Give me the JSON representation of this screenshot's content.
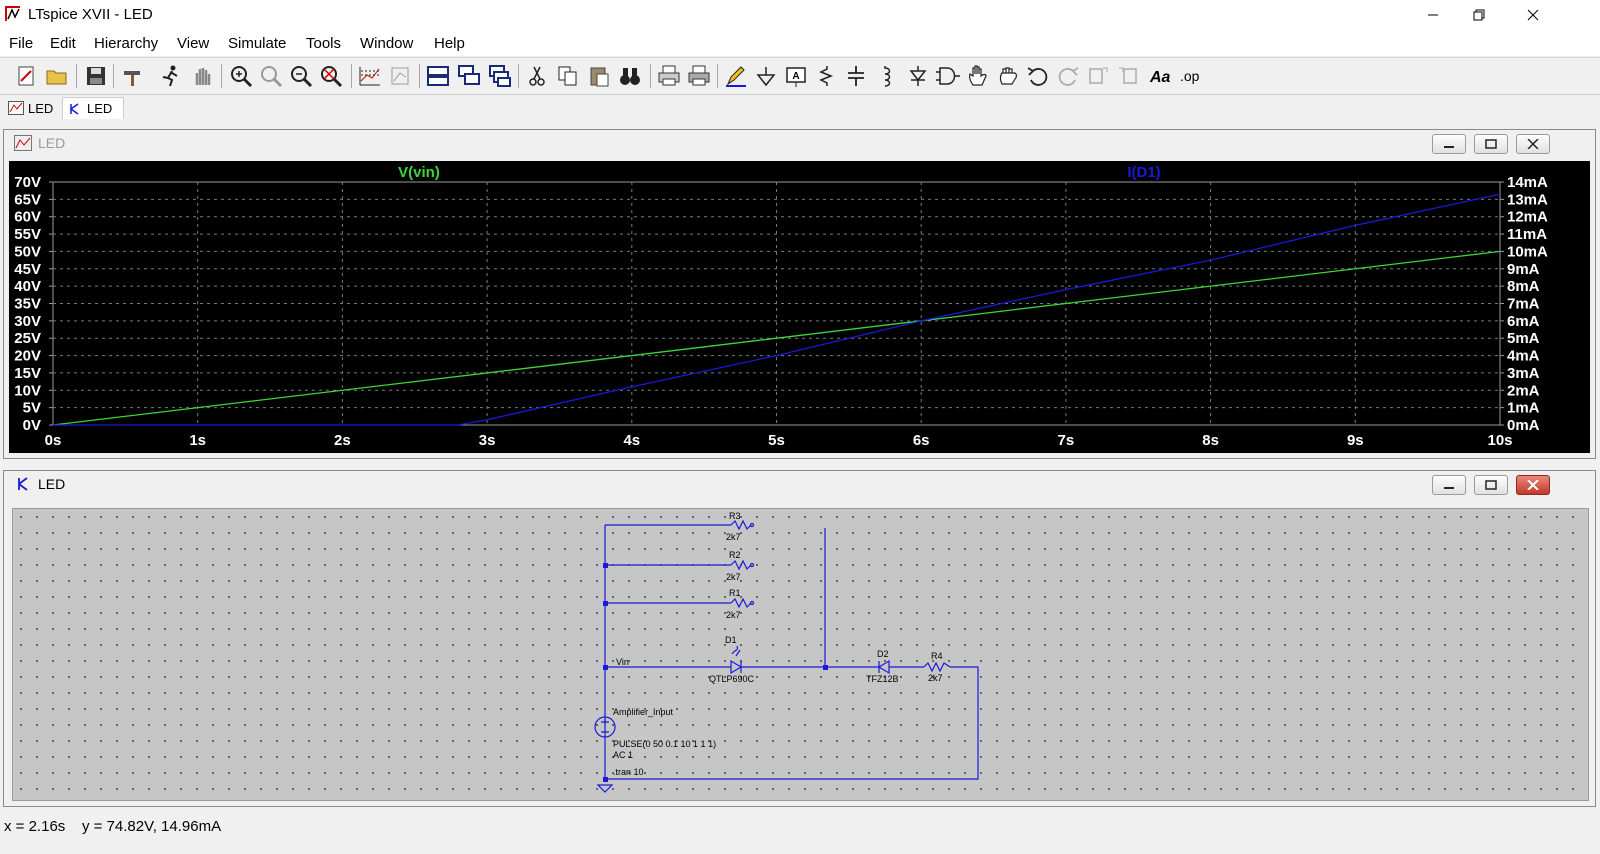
{
  "window": {
    "title": "LTspice XVII - LED"
  },
  "menu": [
    "File",
    "Edit",
    "Hierarchy",
    "View",
    "Simulate",
    "Tools",
    "Window",
    "Help"
  ],
  "tabs": [
    {
      "label": "LED"
    },
    {
      "label": "LED"
    }
  ],
  "waveform_panel": {
    "title": "LED"
  },
  "schematic_panel": {
    "title": "LED"
  },
  "chart_data": {
    "type": "line",
    "x_tick_labels": [
      "0s",
      "1s",
      "2s",
      "3s",
      "4s",
      "5s",
      "6s",
      "7s",
      "8s",
      "9s",
      "10s"
    ],
    "y_left_tick_labels": [
      "0V",
      "5V",
      "10V",
      "15V",
      "20V",
      "25V",
      "30V",
      "35V",
      "40V",
      "45V",
      "50V",
      "55V",
      "60V",
      "65V",
      "70V"
    ],
    "y_right_tick_labels": [
      "0mA",
      "1mA",
      "2mA",
      "3mA",
      "4mA",
      "5mA",
      "6mA",
      "7mA",
      "8mA",
      "9mA",
      "10mA",
      "11mA",
      "12mA",
      "13mA",
      "14mA"
    ],
    "xlim": [
      0,
      10
    ],
    "ylim_left": [
      0,
      70
    ],
    "ylim_right": [
      0,
      14
    ],
    "grid": true,
    "series": [
      {
        "name": "V(vin)",
        "axis": "left",
        "unit": "V",
        "color": "#3cd63c",
        "x": [
          0,
          10
        ],
        "y": [
          0,
          50
        ]
      },
      {
        "name": "I(D1)",
        "axis": "right",
        "unit": "mA",
        "color": "#1a1ad8",
        "x": [
          0,
          2.8,
          3,
          4,
          5,
          6,
          7,
          8,
          9,
          10
        ],
        "y": [
          0,
          0,
          0.3,
          2.2,
          4.0,
          6.0,
          7.8,
          9.5,
          11.5,
          13.3
        ]
      }
    ]
  },
  "schematic": {
    "resistors": [
      {
        "name": "R3",
        "value": "2k7"
      },
      {
        "name": "R2",
        "value": "2k7"
      },
      {
        "name": "R1",
        "value": "2k7"
      },
      {
        "name": "R4",
        "value": "2k7"
      }
    ],
    "diodes": [
      {
        "name": "D1",
        "model": "QTLP690C"
      },
      {
        "name": "D2",
        "model": "TFZ12B"
      }
    ],
    "net_label": "Vin",
    "source": {
      "name": "Amplifier_Input",
      "value": "PULSE(0 50 0.1 10 1 1 1)",
      "ac": "AC 1"
    },
    "directive": ".tran 10"
  },
  "status": "x = 2.16s    y = 74.82V, 14.96mA",
  "colors": {
    "grid_bg": "#000000",
    "axis_text": "#ffffff",
    "wire": "#1a1ad8",
    "schematic_bg": "#c6c6c6"
  }
}
